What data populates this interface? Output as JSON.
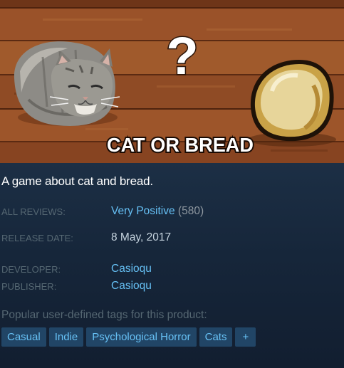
{
  "capsule": {
    "question_mark": "?",
    "logo_text": "CAT OR BREAD"
  },
  "description": "A game about cat and bread.",
  "reviews": {
    "label": "ALL REVIEWS:",
    "summary": "Very Positive",
    "count": "(580)"
  },
  "release": {
    "label": "RELEASE DATE:",
    "date": "8 May, 2017"
  },
  "developer": {
    "label": "DEVELOPER:",
    "name": "Casioqu"
  },
  "publisher": {
    "label": "PUBLISHER:",
    "name": "Casioqu"
  },
  "tags": {
    "heading": "Popular user-defined tags for this product:",
    "items": [
      "Casual",
      "Indie",
      "Psychological Horror",
      "Cats"
    ],
    "more": "+"
  },
  "colors": {
    "background": "#10192a",
    "link": "#66c0f4",
    "label": "#556772",
    "tag_bg": "#214566"
  }
}
